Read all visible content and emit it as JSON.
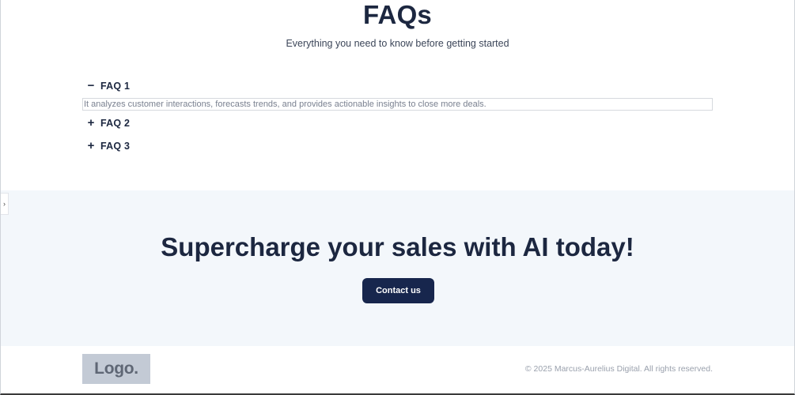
{
  "faq": {
    "title": "FAQs",
    "subtitle": "Everything you need to know before getting started",
    "items": [
      {
        "sign": "−",
        "label": "FAQ 1",
        "expanded": true,
        "answer": "It analyzes customer interactions, forecasts trends, and provides actionable insights to close more deals."
      },
      {
        "sign": "+",
        "label": "FAQ 2",
        "expanded": false
      },
      {
        "sign": "+",
        "label": "FAQ 3",
        "expanded": false
      }
    ]
  },
  "side_toggle": {
    "glyph": "›",
    "icon": "chevron-right-icon"
  },
  "cta": {
    "title": "Supercharge your sales with AI today!",
    "button_label": "Contact us",
    "button_color": "#17264d",
    "background": "#f3f7fb"
  },
  "footer": {
    "logo_text": "Logo.",
    "copyright": "© 2025 Marcus-Aurelius Digital. All rights reserved."
  }
}
